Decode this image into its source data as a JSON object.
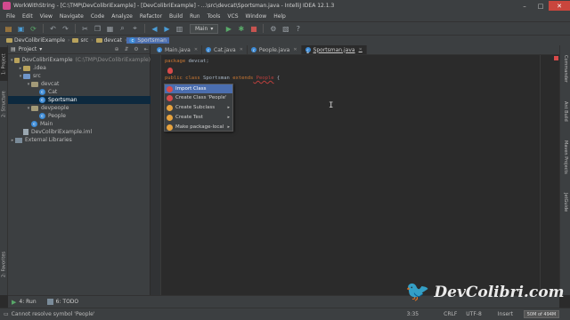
{
  "window": {
    "title": "WorkWithString - [C:\\TMP\\DevColibriExample] - [DevColibriExample] - ...\\src\\devcat\\Sportsman.java - IntelliJ IDEA 12.1.3",
    "controls": [
      "–",
      "□",
      "✕"
    ]
  },
  "menu": [
    "File",
    "Edit",
    "View",
    "Navigate",
    "Code",
    "Analyze",
    "Refactor",
    "Build",
    "Run",
    "Tools",
    "VCS",
    "Window",
    "Help"
  ],
  "toolbar": {
    "run_config": "Main"
  },
  "breadcrumb": [
    "DevColibriExample",
    "src",
    "devcat",
    "Sportsman"
  ],
  "left_tabs": [
    "1: Project",
    "2: Structure",
    "2: Favorites"
  ],
  "right_tabs": [
    "Commander",
    "Ant Build",
    "Maven Projects",
    "JetGuide"
  ],
  "project_panel": {
    "header": "Project",
    "tree": [
      {
        "indent": 0,
        "arrow": "▾",
        "icon": "folder",
        "label": "DevColibriExample",
        "extra": "(C:\\TMP\\DevColibriExample)"
      },
      {
        "indent": 1,
        "arrow": "▸",
        "icon": "folder",
        "label": ".idea"
      },
      {
        "indent": 1,
        "arrow": "▾",
        "icon": "src",
        "label": "src"
      },
      {
        "indent": 2,
        "arrow": "▾",
        "icon": "pkg",
        "label": "devcat"
      },
      {
        "indent": 3,
        "arrow": "",
        "icon": "class",
        "label": "Cat"
      },
      {
        "indent": 3,
        "arrow": "",
        "icon": "class",
        "label": "Sportsman",
        "selected": true
      },
      {
        "indent": 2,
        "arrow": "▾",
        "icon": "pkg",
        "label": "devpeople"
      },
      {
        "indent": 3,
        "arrow": "",
        "icon": "class",
        "label": "People"
      },
      {
        "indent": 2,
        "arrow": "",
        "icon": "class",
        "label": "Main"
      },
      {
        "indent": 1,
        "arrow": "",
        "icon": "file",
        "label": "DevColibriExample.iml"
      },
      {
        "indent": 0,
        "arrow": "▸",
        "icon": "lib",
        "label": "External Libraries"
      }
    ]
  },
  "editor": {
    "tabs": [
      {
        "label": "Main.java",
        "active": false
      },
      {
        "label": "Cat.java",
        "active": false
      },
      {
        "label": "People.java",
        "active": false
      },
      {
        "label": "Sportsman.java",
        "active": true
      }
    ],
    "line1": {
      "kw": "package",
      "rest": " devcat;"
    },
    "line3": {
      "kw1": "public class",
      "name": " Sportsman ",
      "kw2": "extends",
      "err": " People",
      "rest": " {"
    }
  },
  "popup": {
    "items": [
      {
        "label": "Import Class",
        "icon": "red",
        "submenu": false,
        "selected": true
      },
      {
        "label": "Create Class 'People'",
        "icon": "red",
        "submenu": false,
        "selected": false
      },
      {
        "label": "Create Subclass",
        "icon": "orange",
        "submenu": true,
        "selected": false
      },
      {
        "label": "Create Test",
        "icon": "orange",
        "submenu": true,
        "selected": false
      },
      {
        "label": "Make package-local",
        "icon": "orange",
        "submenu": true,
        "selected": false
      }
    ]
  },
  "bottom_tools": [
    {
      "label": "4: Run",
      "icon": "green"
    },
    {
      "label": "6: TODO",
      "icon": "todo"
    }
  ],
  "status": {
    "message": "Cannot resolve symbol 'People'",
    "position": "3:35",
    "line_sep": "CRLF",
    "encoding": "UTF-8",
    "mode": "Insert",
    "memory": "50M of 494M"
  },
  "watermark": {
    "text": "DevColibri.com"
  }
}
